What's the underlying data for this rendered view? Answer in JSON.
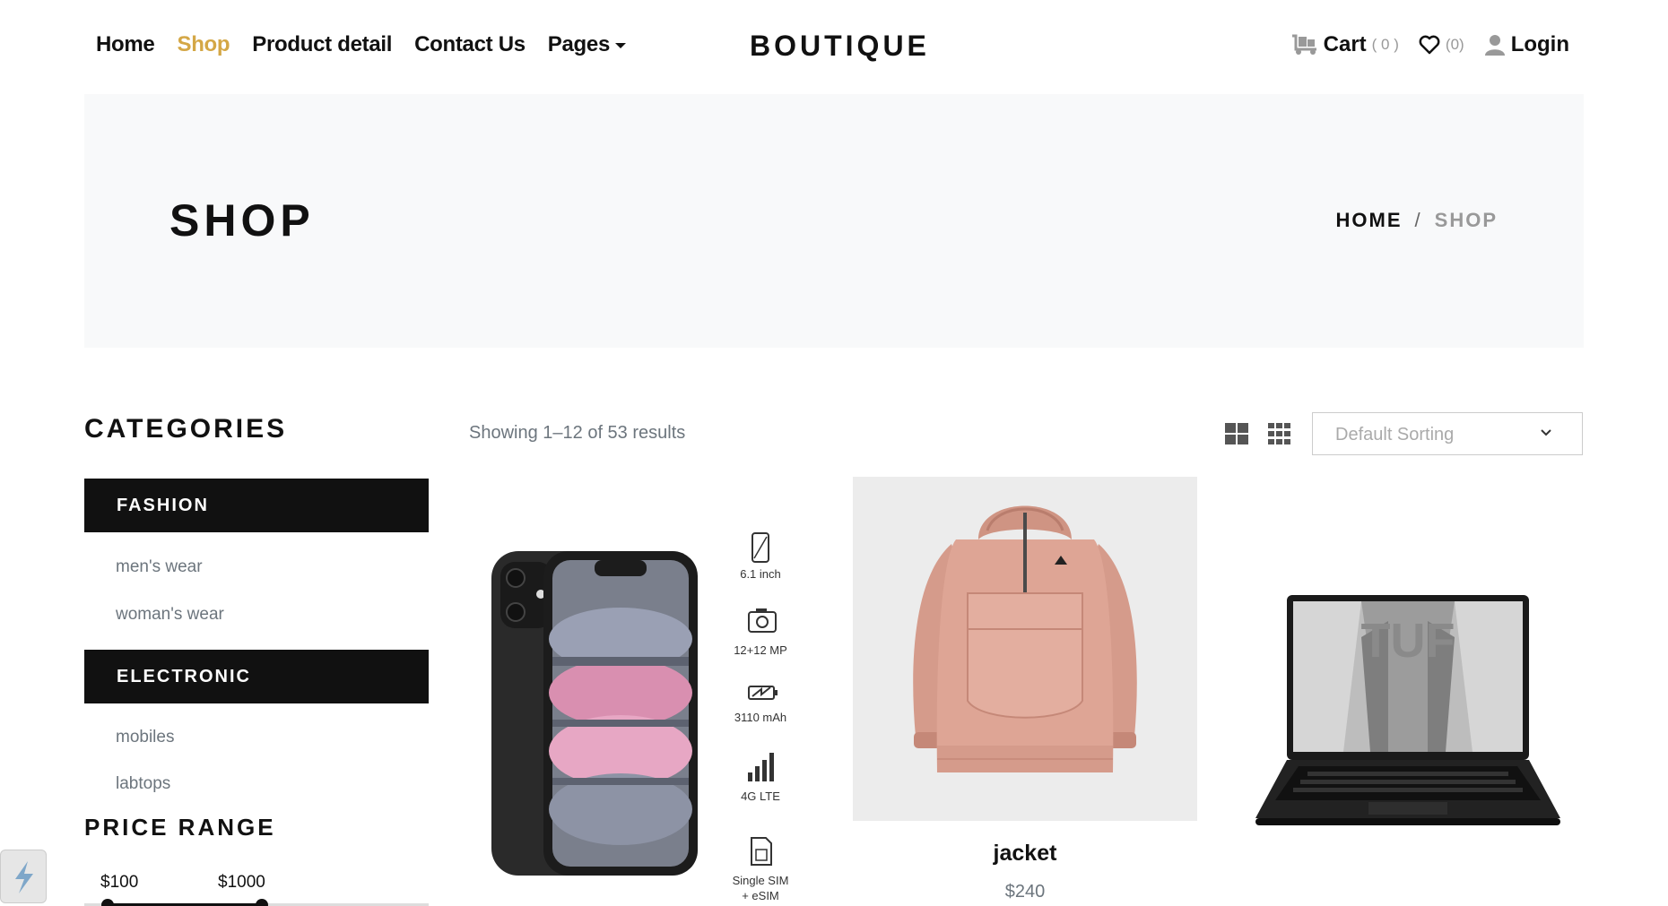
{
  "nav": {
    "links": [
      {
        "label": "Home",
        "active": false
      },
      {
        "label": "Shop",
        "active": true
      },
      {
        "label": "Product detail",
        "active": false
      },
      {
        "label": "Contact Us",
        "active": false
      },
      {
        "label": "Pages",
        "active": false
      }
    ],
    "brand": "BOUTIQUE",
    "cart_label": "Cart",
    "cart_count": "( 0 )",
    "wishlist_count": "(0)",
    "login_label": "Login",
    "accent_color": "#d4a746"
  },
  "hero": {
    "title": "SHOP",
    "breadcrumb_home": "HOME",
    "breadcrumb_sep": "/",
    "breadcrumb_current": "SHOP"
  },
  "sidebar": {
    "categories_title": "CATEGORIES",
    "groups": [
      {
        "title": "FASHION",
        "items": [
          "men's wear",
          "woman's wear"
        ]
      },
      {
        "title": "ELECTRONIC",
        "items": [
          "mobiles",
          "labtops"
        ]
      }
    ],
    "price_title": "PRICE RANGE",
    "price_min": "$100",
    "price_max": "$1000"
  },
  "toolbar": {
    "results_text": "Showing 1–12 of 53 results",
    "sort_value": "Default Sorting"
  },
  "products": [
    {
      "name": "",
      "price": "",
      "image": "smartphone-image",
      "specs": [
        "6.1 inch",
        "12+12 MP",
        "3110 mAh",
        "4G LTE",
        "Single SIM",
        "+ eSIM"
      ]
    },
    {
      "name": "jacket",
      "price": "$240",
      "image": "jacket-image"
    },
    {
      "name": "",
      "price": "",
      "image": "laptop-image",
      "screen_text": "TUF"
    }
  ]
}
